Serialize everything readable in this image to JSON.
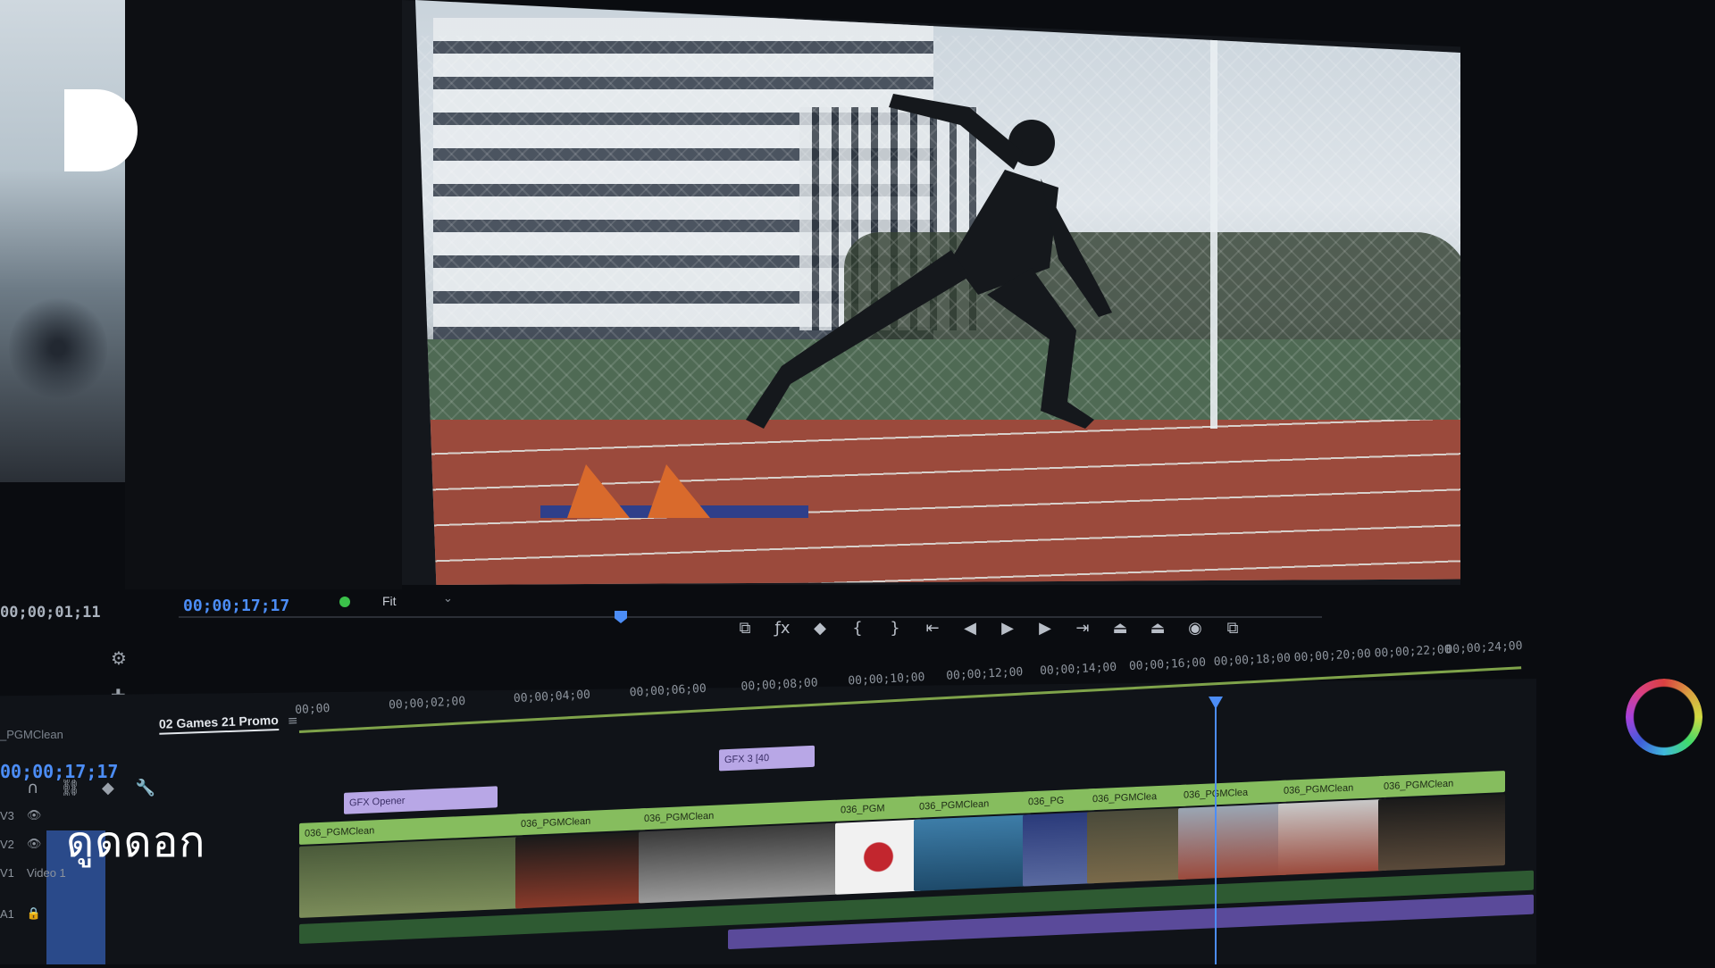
{
  "brand": {
    "logo_icon": "d-logo-icon",
    "caption": "ดูดดอก"
  },
  "source_monitor": {
    "timecode": "00;00;01;11"
  },
  "program_monitor": {
    "timecode": "00;00;17;17",
    "fit_label": "Fit",
    "fit_chevron": "⌄",
    "transport_icons": [
      "export-frame-icon",
      "fx-icon",
      "marker-icon",
      "mark-in-icon",
      "mark-out-icon",
      "go-to-in-icon",
      "step-back-icon",
      "play-icon",
      "step-forward-icon",
      "go-to-out-icon",
      "lift-icon",
      "extract-icon",
      "camera-icon",
      "button-editor-icon"
    ],
    "transport_glyphs": [
      "⧉",
      "ƒx",
      "◆",
      "{",
      "}",
      "⇤",
      "◀",
      "▶",
      "▶",
      "⇥",
      "⏏",
      "⏏",
      "◉",
      "⧉"
    ]
  },
  "timeline": {
    "panel_left_label": "_PGMClean",
    "sequence_tab": "02 Games 21 Promo",
    "sequence_menu": "≡",
    "timecode": "00;00;17;17",
    "ruler_labels": [
      "00;00",
      "00;00;02;00",
      "00;00;04;00",
      "00;00;06;00",
      "00;00;08;00",
      "00;00;10;00",
      "00;00;12;00",
      "00;00;14;00",
      "00;00;16;00",
      "00;00;18;00",
      "00;00;20;00",
      "00;00;22;00",
      "00;00;24;00"
    ],
    "tracks": [
      {
        "name": "V3"
      },
      {
        "name": "V2"
      },
      {
        "name": "V1",
        "label": "Video 1"
      },
      {
        "name": "A1"
      }
    ],
    "clips": [
      {
        "label": "GFX Opener",
        "kind": "gfx"
      },
      {
        "label": "GFX 3 [40",
        "kind": "gfx"
      },
      {
        "label": "036_PGMClean",
        "kind": "v1"
      },
      {
        "label": "036_PGMClean",
        "kind": "v1"
      },
      {
        "label": "036_PGMClean",
        "kind": "v1"
      },
      {
        "label": "036_PGM",
        "kind": "v1"
      },
      {
        "label": "036_PGMClean",
        "kind": "v1"
      },
      {
        "label": "036_PG",
        "kind": "v1"
      },
      {
        "label": "036_PGMClea",
        "kind": "v1"
      },
      {
        "label": "036_PGMClea",
        "kind": "v1"
      },
      {
        "label": "036_PGMClean",
        "kind": "v1"
      },
      {
        "label": "036_PGMClean",
        "kind": "v1"
      }
    ]
  },
  "colors": {
    "accent_blue": "#4c8df6",
    "clip_green": "#86bd5e",
    "clip_purple": "#b8a7e6",
    "brand_white": "#ffffff"
  }
}
